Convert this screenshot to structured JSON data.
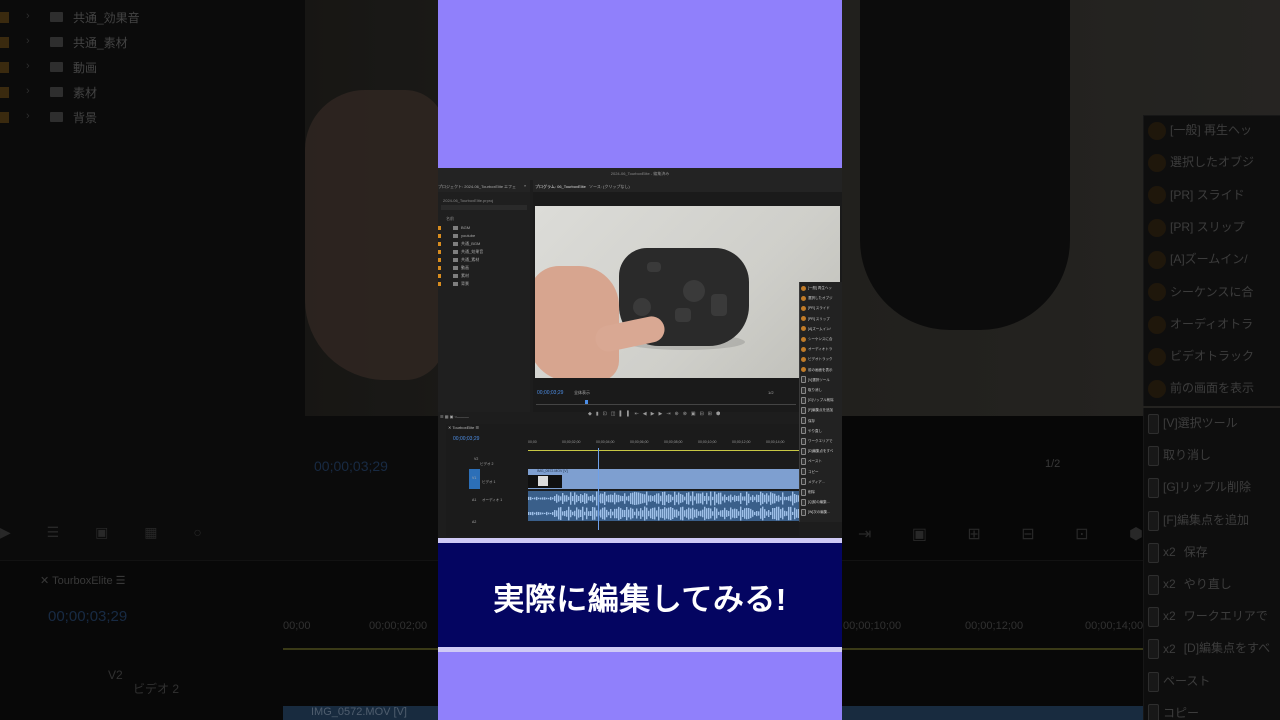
{
  "background": {
    "project_folders": [
      "共通_効果音",
      "共通_素材",
      "動画",
      "素材",
      "背景"
    ],
    "timecode": "00;00;03;29",
    "page_indicator": "1/2",
    "timeline": {
      "sequence_name": "TourboxElite",
      "timecode": "00;00;03;29",
      "ruler_labels": [
        "00;00",
        "00;00;02;00",
        "00;00;10;00",
        "00;00;12;00",
        "00;00;14;00"
      ],
      "track_v2": "V2",
      "track_v2_name": "ビデオ 2",
      "clip_name": "IMG_0572.MOV [V]"
    },
    "function_panel": [
      {
        "label": "[一般] 再生ヘッ",
        "prefix": ""
      },
      {
        "label": "選択したオブジ",
        "prefix": ""
      },
      {
        "label": "[PR] スライド",
        "prefix": ""
      },
      {
        "label": "[PR] スリップ",
        "prefix": ""
      },
      {
        "label": "[A]ズームイン/",
        "prefix": ""
      },
      {
        "label": "シーケンスに合",
        "prefix": ""
      },
      {
        "label": "オーディオトラ",
        "prefix": ""
      },
      {
        "label": "ビデオトラック",
        "prefix": ""
      },
      {
        "label": "前の画面を表示",
        "prefix": ""
      }
    ],
    "function_panel_2": [
      {
        "label": "[V]選択ツール",
        "prefix": ""
      },
      {
        "label": "取り消し",
        "prefix": ""
      },
      {
        "label": "[G]リップル削除",
        "prefix": ""
      },
      {
        "label": "[F]編集点を追加",
        "prefix": ""
      },
      {
        "label": "保存",
        "prefix": "x2"
      },
      {
        "label": "やり直し",
        "prefix": "x2"
      },
      {
        "label": "ワークエリアで",
        "prefix": "x2"
      },
      {
        "label": "[D]編集点をすべ",
        "prefix": "x2"
      },
      {
        "label": "ペースト",
        "prefix": ""
      },
      {
        "label": "コピー",
        "prefix": ""
      }
    ]
  },
  "premiere": {
    "window_title": "2024-06_TourboxElite - 編集済み",
    "project_tab": "プロジェクト: 2024-06_TourboxElite",
    "project_tab2": "エフェ",
    "project_file": "2024-06_TourboxElite.prproj",
    "name_header": "名前",
    "folders": [
      "BGM",
      "youtube",
      "共通_BGM",
      "共通_効果音",
      "共通_素材",
      "動画",
      "素材",
      "背景"
    ],
    "program_tab": "プログラム: 06_TourboxElite",
    "source_tab": "ソース: (クリップなし)",
    "timecode": "00;00;03;29",
    "fit": "全体表示",
    "quality": "1/2",
    "sequence_name": "TourboxElite",
    "seq_timecode": "00;00;03;29",
    "ruler": [
      "00;00",
      "00;00;02;00",
      "00;00;04;00",
      "00;00;06;00",
      "00;00;08;00",
      "00;00;10;00",
      "00;00;12;00",
      "00;00;14;00"
    ],
    "tracks": {
      "v2": "V2",
      "v2_name": "ビデオ 2",
      "v1": "V1",
      "v1_name": "ビデオ 1",
      "a1": "A1",
      "a1_name": "オーディオ 1",
      "a2": "A2"
    },
    "clip_name": "IMG_0572.MOV [V]",
    "tourbox_panel": [
      "[一般] 再生ヘッ",
      "選択したオブジ",
      "[PR] スライド",
      "[PR] スリップ",
      "[A]ズームイン/",
      "シーケンスに合",
      "オーディオトラ",
      "ビデオトラック",
      "前の画面を表示",
      "[V]選択ツール",
      "取り消し",
      "[G]リップル削除",
      "[F]編集点を追加",
      "保存",
      "やり直し",
      "ワークエリアで",
      "[D]編集点をすべ",
      "ペースト",
      "コピー",
      "メディア...",
      "削除",
      "[Q]前の編集...",
      "[W]次の編集..."
    ]
  },
  "caption": "実際に編集してみる!",
  "colors": {
    "center_bg": "#9080fb",
    "caption_band": "#040561",
    "caption_text": "#ffffff",
    "timecode_blue": "#4d8ee6",
    "clip_blue": "#7e9fd0"
  }
}
